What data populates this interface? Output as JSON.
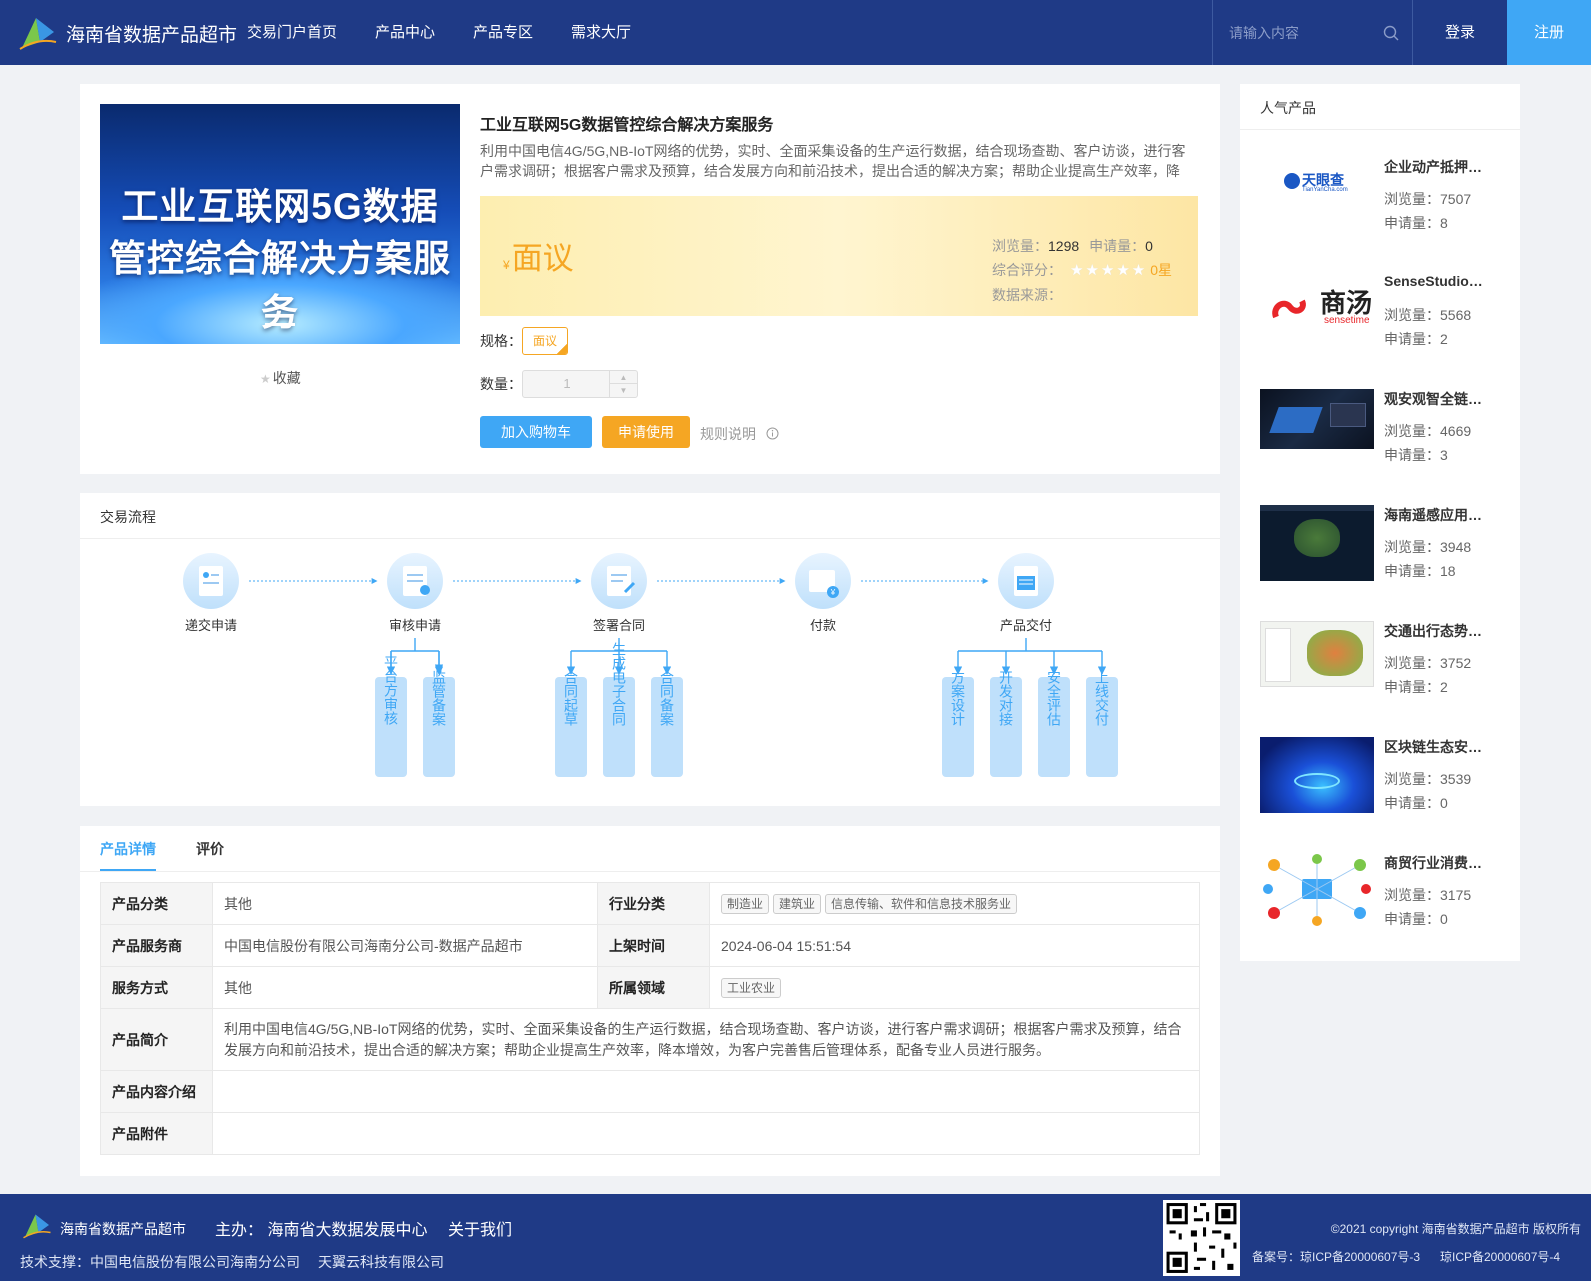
{
  "header": {
    "site_title": "海南省数据产品超市",
    "nav": [
      "交易门户首页",
      "产品中心",
      "产品专区",
      "需求大厅"
    ],
    "search_placeholder": "请输入内容",
    "login": "登录",
    "register": "注册"
  },
  "product": {
    "banner_line1": "工业互联网5G数据",
    "banner_line2": "管控综合解决方案服务",
    "favorite": "收藏",
    "title": "工业互联网5G数据管控综合解决方案服务",
    "desc": "利用中国电信4G/5G,NB-IoT网络的优势，实时、全面采集设备的生产运行数据，结合现场查勘、客户访谈，进行客户需求调研；根据客户需求及预算，结合发展方向和前沿技术，提出合适的解决方案；帮助企业提高生产效率，降本增效，为客户完善售后管理体系，配备专业人员进行服务。",
    "currency": "¥",
    "price": "面议",
    "views_label": "浏览量：",
    "views": "1298",
    "applies_label": "申请量：",
    "applies": "0",
    "rating_label": "综合评分：",
    "rating_stars": "★★★★★",
    "rating_value": "0星",
    "source_label": "数据来源：",
    "spec_label": "规格：",
    "spec_value": "面议",
    "qty_label": "数量：",
    "qty_value": "1",
    "add_cart": "加入购物车",
    "apply": "申请使用",
    "rules": "规则说明",
    "accent_blue": "#3fa7f5",
    "accent_orange": "#f5a623"
  },
  "flow": {
    "title": "交易流程",
    "steps": [
      "递交申请",
      "审核申请",
      "签署合同",
      "付款",
      "产品交付"
    ],
    "sub_audit": [
      "平台方审核",
      "监管备案"
    ],
    "sub_contract": [
      "合同起草",
      "生成电子合同",
      "合同备案"
    ],
    "sub_delivery": [
      "方案设计",
      "开发对接",
      "安全评估",
      "上线交付"
    ]
  },
  "details": {
    "tabs": [
      "产品详情",
      "评价"
    ],
    "category_label": "产品分类",
    "category": "其他",
    "industry_label": "行业分类",
    "industry_tags": [
      "制造业",
      "建筑业",
      "信息传输、软件和信息技术服务业"
    ],
    "provider_label": "产品服务商",
    "provider": "中国电信股份有限公司海南分公司-数据产品超市",
    "launch_label": "上架时间",
    "launch": "2024-06-04 15:51:54",
    "service_label": "服务方式",
    "service": "其他",
    "domain_label": "所属领域",
    "domain_tags": [
      "工业农业"
    ],
    "intro_label": "产品简介",
    "intro": "利用中国电信4G/5G,NB-IoT网络的优势，实时、全面采集设备的生产运行数据，结合现场查勘、客户访谈，进行客户需求调研；根据客户需求及预算，结合发展方向和前沿技术，提出合适的解决方案；帮助企业提高生产效率，降本增效，为客户完善售后管理体系，配备专业人员进行服务。",
    "content_label": "产品内容介绍",
    "attach_label": "产品附件"
  },
  "sidebar": {
    "title": "人气产品",
    "items": [
      {
        "name": "企业动产抵押…",
        "views": "浏览量：7507",
        "applies": "申请量：8",
        "logo_text": "天眼查",
        "logo_sub": "TianYanCha.com"
      },
      {
        "name": "SenseStudio…",
        "views": "浏览量：5568",
        "applies": "申请量：2",
        "logo_text": "商汤",
        "logo_sub": "sensetime"
      },
      {
        "name": "观安观智全链…",
        "views": "浏览量：4669",
        "applies": "申请量：3"
      },
      {
        "name": "海南遥感应用…",
        "views": "浏览量：3948",
        "applies": "申请量：18"
      },
      {
        "name": "交通出行态势…",
        "views": "浏览量：3752",
        "applies": "申请量：2"
      },
      {
        "name": "区块链生态安…",
        "views": "浏览量：3539",
        "applies": "申请量：0"
      },
      {
        "name": "商贸行业消费…",
        "views": "浏览量：3175",
        "applies": "申请量：0"
      }
    ]
  },
  "footer": {
    "site": "海南省数据产品超市",
    "host": "主办： 海南省大数据发展中心",
    "about": "关于我们",
    "tech_support": "技术支撑：中国电信股份有限公司海南分公司",
    "tech_support2": "天翼云科技有限公司",
    "copyright": "©2021 copyright 海南省数据产品超市 版权所有",
    "icp1": "备案号：琼ICP备20000607号-3",
    "icp2": "琼ICP备20000607号-4"
  }
}
